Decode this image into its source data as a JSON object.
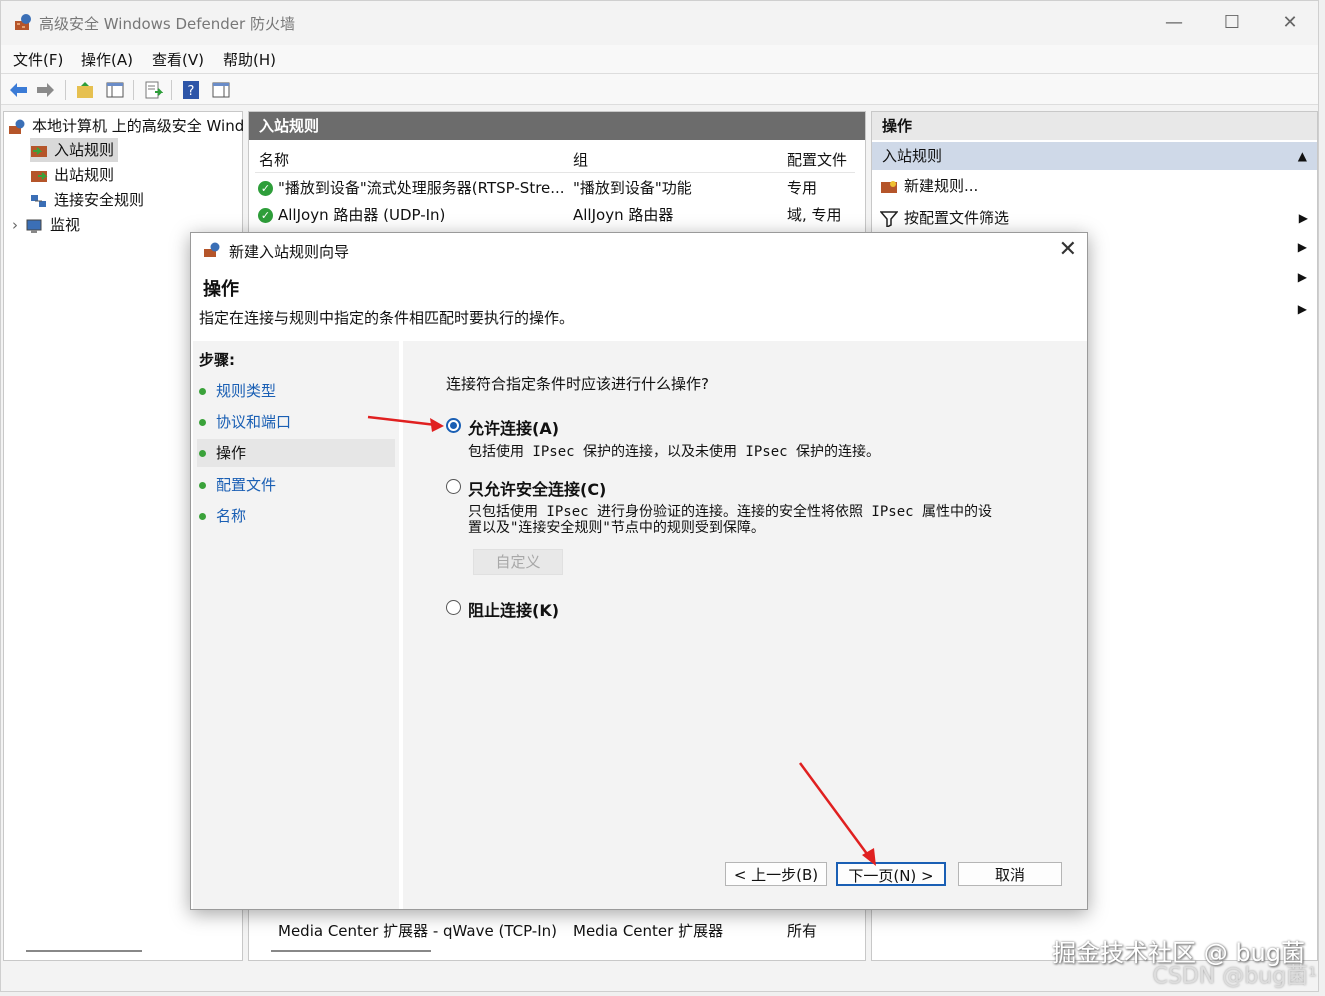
{
  "window": {
    "title": "高级安全 Windows Defender 防火墙",
    "min": "—",
    "max": "☐",
    "close": "✕"
  },
  "menu": [
    "文件(F)",
    "操作(A)",
    "查看(V)",
    "帮助(H)"
  ],
  "tree": {
    "root": "本地计算机 上的高级安全 Wind",
    "items": [
      "入站规则",
      "出站规则",
      "连接安全规则",
      "监视"
    ],
    "expander": "›"
  },
  "middle": {
    "header": "入站规则",
    "columns": [
      "名称",
      "组",
      "配置文件"
    ],
    "rows": [
      [
        "\"播放到设备\"流式处理服务器(RTSP-Stre...",
        "\"播放到设备\"功能",
        "专用"
      ],
      [
        "AllJoyn 路由器 (UDP-In)",
        "AllJoyn 路由器",
        "域, 专用"
      ]
    ],
    "bottom_row": [
      "Media Center 扩展器 - qWave (TCP-In)",
      "Media Center 扩展器",
      "所有"
    ]
  },
  "actions": {
    "header": "操作",
    "section": "入站规则",
    "items": [
      "新建规则...",
      "按配置文件筛选"
    ]
  },
  "dialog": {
    "title": "新建入站规则向导",
    "close": "✕",
    "heading": "操作",
    "subtitle": "指定在连接与规则中指定的条件相匹配时要执行的操作。",
    "steps_label": "步骤:",
    "steps": [
      "规则类型",
      "协议和端口",
      "操作",
      "配置文件",
      "名称"
    ],
    "question": "连接符合指定条件时应该进行什么操作?",
    "options": [
      {
        "label": "允许连接(A)",
        "desc": "包括使用 IPsec 保护的连接，以及未使用 IPsec 保护的连接。",
        "selected": true
      },
      {
        "label": "只允许安全连接(C)",
        "desc1": "只包括使用 IPsec 进行身份验证的连接。连接的安全性将依照 IPsec 属性中的设",
        "desc2": "置以及\"连接安全规则\"节点中的规则受到保障。",
        "selected": false
      },
      {
        "label": "阻止连接(K)",
        "selected": false
      }
    ],
    "customize": "自定义",
    "buttons": {
      "back": "< 上一步(B)",
      "next": "下一页(N) >",
      "cancel": "取消"
    }
  },
  "watermark": {
    "line1": "掘金技术社区 @ bug菌",
    "line2": "CSDN @bug菌¹"
  },
  "colors": {
    "accent": "#1a5fb4",
    "pane_header": "#6c6c6c",
    "arrow": "#e02020",
    "check": "#2e9e3a"
  }
}
